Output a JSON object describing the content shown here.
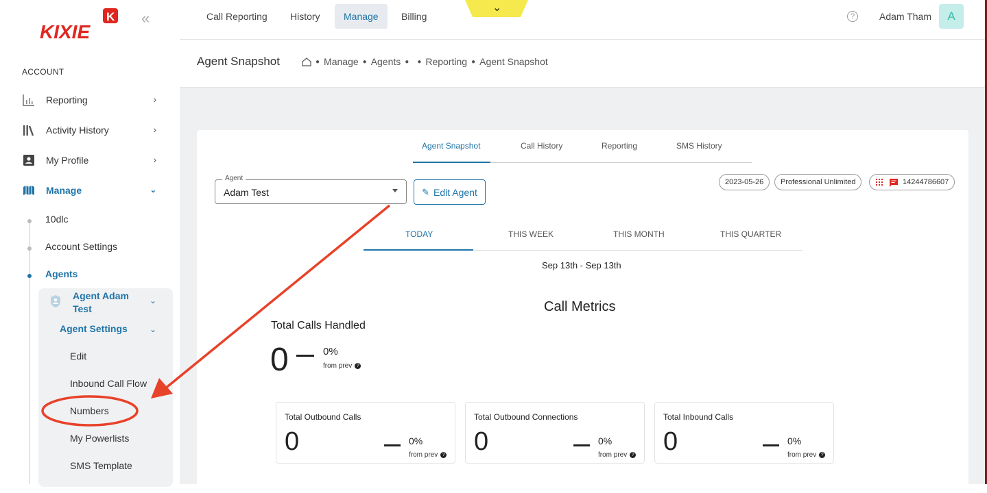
{
  "brand": {
    "name": "KIXIE",
    "badge": "K"
  },
  "sidebar": {
    "section_label": "ACCOUNT",
    "items": [
      {
        "label": "Reporting",
        "icon": "bar-chart-icon"
      },
      {
        "label": "Activity History",
        "icon": "library-icon"
      },
      {
        "label": "My Profile",
        "icon": "profile-card-icon"
      },
      {
        "label": "Manage",
        "icon": "manage-icon",
        "active": true
      }
    ],
    "manage_sub": [
      "10dlc",
      "Account Settings",
      "Agents"
    ],
    "agent_name": "Agent Adam Test",
    "agent_settings": "Agent Settings",
    "agent_settings_items": [
      "Edit",
      "Inbound Call Flow",
      "Numbers",
      "My Powerlists",
      "SMS Template"
    ]
  },
  "topnav": {
    "tabs": [
      "Call Reporting",
      "History",
      "Manage",
      "Billing"
    ],
    "active_tab": "Manage",
    "user_name": "Adam Tham",
    "avatar_initial": "A",
    "help_glyph": "?"
  },
  "header": {
    "page_title": "Agent Snapshot",
    "breadcrumbs": [
      "Manage",
      "Agents",
      "",
      "Reporting",
      "Agent Snapshot"
    ]
  },
  "content": {
    "tabs": [
      "Agent Snapshot",
      "Call History",
      "Reporting",
      "SMS History"
    ],
    "active_tab": "Agent Snapshot",
    "agent_select": {
      "label": "Agent",
      "value": "Adam Test"
    },
    "edit_button": "Edit Agent",
    "chips": {
      "date": "2023-05-26",
      "plan": "Professional Unlimited",
      "phone": "14244786607"
    },
    "periods": [
      "TODAY",
      "THIS WEEK",
      "THIS MONTH",
      "THIS QUARTER"
    ],
    "active_period": "TODAY",
    "date_range": "Sep 13th - Sep 13th",
    "metrics_title": "Call Metrics",
    "total_calls": {
      "label": "Total Calls Handled",
      "value": "0",
      "pct": "0%",
      "from_prev": "from prev"
    },
    "cards": [
      {
        "title": "Total Outbound Calls",
        "value": "0",
        "pct": "0%",
        "from_prev": "from prev"
      },
      {
        "title": "Total Outbound Connections",
        "value": "0",
        "pct": "0%",
        "from_prev": "from prev"
      },
      {
        "title": "Total Inbound Calls",
        "value": "0",
        "pct": "0%",
        "from_prev": "from prev"
      }
    ]
  },
  "colors": {
    "accent": "#1f74a8",
    "brand_red": "#e0261f",
    "annotation": "#e8422a",
    "yellow": "#f6e94d"
  }
}
